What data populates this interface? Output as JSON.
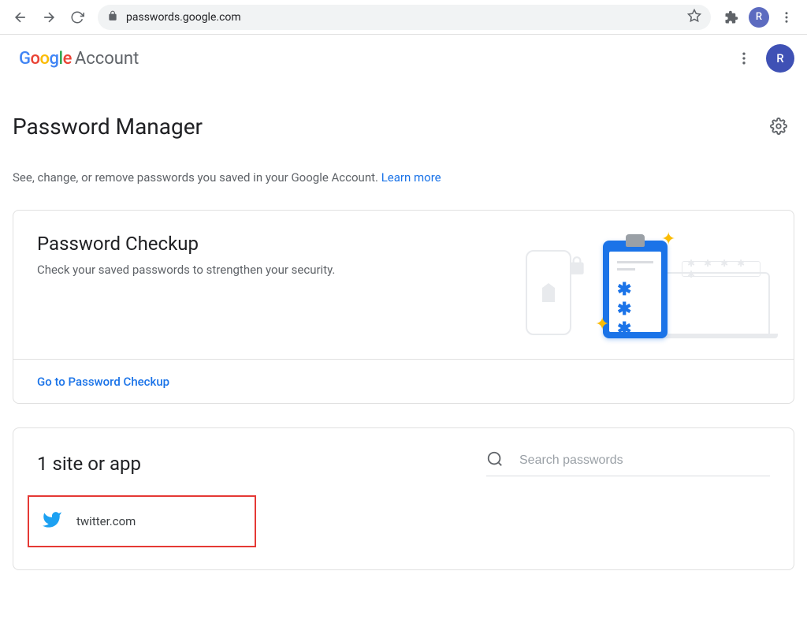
{
  "browser": {
    "url": "passwords.google.com",
    "avatar_letter": "R"
  },
  "header": {
    "logo_letters": [
      "G",
      "o",
      "o",
      "g",
      "l",
      "e"
    ],
    "account_word": "Account",
    "avatar_letter": "R"
  },
  "page": {
    "title": "Password Manager",
    "description_pre": "See, change, or remove passwords you saved in your Google Account. ",
    "learn_more": "Learn more"
  },
  "checkup": {
    "title": "Password Checkup",
    "description": "Check your saved passwords to strengthen your security.",
    "cta": "Go to Password Checkup",
    "illus_stars": "✱ ✱ ✱",
    "illus_dots": "✱ ✱ ✱ ✱ ✱"
  },
  "sites": {
    "heading": "1 site or app",
    "search_placeholder": "Search passwords",
    "items": [
      {
        "name": "twitter.com",
        "icon": "twitter"
      }
    ]
  }
}
